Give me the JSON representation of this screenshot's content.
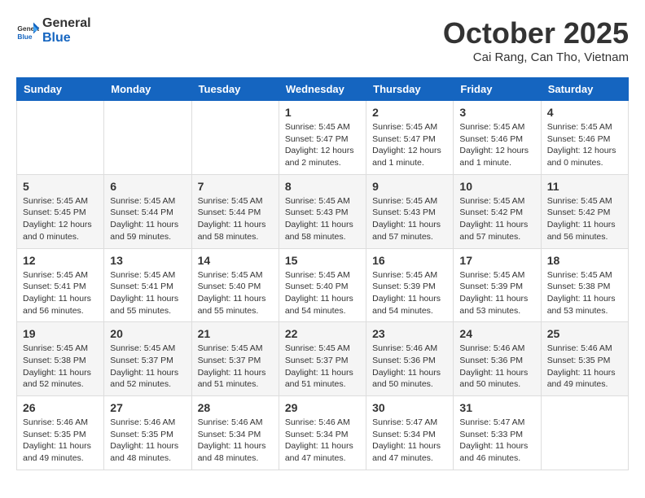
{
  "header": {
    "logo_general": "General",
    "logo_blue": "Blue",
    "month_title": "October 2025",
    "subtitle": "Cai Rang, Can Tho, Vietnam"
  },
  "days_of_week": [
    "Sunday",
    "Monday",
    "Tuesday",
    "Wednesday",
    "Thursday",
    "Friday",
    "Saturday"
  ],
  "weeks": [
    [
      null,
      null,
      null,
      {
        "day": "1",
        "info": "Sunrise: 5:45 AM\nSunset: 5:47 PM\nDaylight: 12 hours and 2 minutes."
      },
      {
        "day": "2",
        "info": "Sunrise: 5:45 AM\nSunset: 5:47 PM\nDaylight: 12 hours and 1 minute."
      },
      {
        "day": "3",
        "info": "Sunrise: 5:45 AM\nSunset: 5:46 PM\nDaylight: 12 hours and 1 minute."
      },
      {
        "day": "4",
        "info": "Sunrise: 5:45 AM\nSunset: 5:46 PM\nDaylight: 12 hours and 0 minutes."
      }
    ],
    [
      {
        "day": "5",
        "info": "Sunrise: 5:45 AM\nSunset: 5:45 PM\nDaylight: 12 hours and 0 minutes."
      },
      {
        "day": "6",
        "info": "Sunrise: 5:45 AM\nSunset: 5:44 PM\nDaylight: 11 hours and 59 minutes."
      },
      {
        "day": "7",
        "info": "Sunrise: 5:45 AM\nSunset: 5:44 PM\nDaylight: 11 hours and 58 minutes."
      },
      {
        "day": "8",
        "info": "Sunrise: 5:45 AM\nSunset: 5:43 PM\nDaylight: 11 hours and 58 minutes."
      },
      {
        "day": "9",
        "info": "Sunrise: 5:45 AM\nSunset: 5:43 PM\nDaylight: 11 hours and 57 minutes."
      },
      {
        "day": "10",
        "info": "Sunrise: 5:45 AM\nSunset: 5:42 PM\nDaylight: 11 hours and 57 minutes."
      },
      {
        "day": "11",
        "info": "Sunrise: 5:45 AM\nSunset: 5:42 PM\nDaylight: 11 hours and 56 minutes."
      }
    ],
    [
      {
        "day": "12",
        "info": "Sunrise: 5:45 AM\nSunset: 5:41 PM\nDaylight: 11 hours and 56 minutes."
      },
      {
        "day": "13",
        "info": "Sunrise: 5:45 AM\nSunset: 5:41 PM\nDaylight: 11 hours and 55 minutes."
      },
      {
        "day": "14",
        "info": "Sunrise: 5:45 AM\nSunset: 5:40 PM\nDaylight: 11 hours and 55 minutes."
      },
      {
        "day": "15",
        "info": "Sunrise: 5:45 AM\nSunset: 5:40 PM\nDaylight: 11 hours and 54 minutes."
      },
      {
        "day": "16",
        "info": "Sunrise: 5:45 AM\nSunset: 5:39 PM\nDaylight: 11 hours and 54 minutes."
      },
      {
        "day": "17",
        "info": "Sunrise: 5:45 AM\nSunset: 5:39 PM\nDaylight: 11 hours and 53 minutes."
      },
      {
        "day": "18",
        "info": "Sunrise: 5:45 AM\nSunset: 5:38 PM\nDaylight: 11 hours and 53 minutes."
      }
    ],
    [
      {
        "day": "19",
        "info": "Sunrise: 5:45 AM\nSunset: 5:38 PM\nDaylight: 11 hours and 52 minutes."
      },
      {
        "day": "20",
        "info": "Sunrise: 5:45 AM\nSunset: 5:37 PM\nDaylight: 11 hours and 52 minutes."
      },
      {
        "day": "21",
        "info": "Sunrise: 5:45 AM\nSunset: 5:37 PM\nDaylight: 11 hours and 51 minutes."
      },
      {
        "day": "22",
        "info": "Sunrise: 5:45 AM\nSunset: 5:37 PM\nDaylight: 11 hours and 51 minutes."
      },
      {
        "day": "23",
        "info": "Sunrise: 5:46 AM\nSunset: 5:36 PM\nDaylight: 11 hours and 50 minutes."
      },
      {
        "day": "24",
        "info": "Sunrise: 5:46 AM\nSunset: 5:36 PM\nDaylight: 11 hours and 50 minutes."
      },
      {
        "day": "25",
        "info": "Sunrise: 5:46 AM\nSunset: 5:35 PM\nDaylight: 11 hours and 49 minutes."
      }
    ],
    [
      {
        "day": "26",
        "info": "Sunrise: 5:46 AM\nSunset: 5:35 PM\nDaylight: 11 hours and 49 minutes."
      },
      {
        "day": "27",
        "info": "Sunrise: 5:46 AM\nSunset: 5:35 PM\nDaylight: 11 hours and 48 minutes."
      },
      {
        "day": "28",
        "info": "Sunrise: 5:46 AM\nSunset: 5:34 PM\nDaylight: 11 hours and 48 minutes."
      },
      {
        "day": "29",
        "info": "Sunrise: 5:46 AM\nSunset: 5:34 PM\nDaylight: 11 hours and 47 minutes."
      },
      {
        "day": "30",
        "info": "Sunrise: 5:47 AM\nSunset: 5:34 PM\nDaylight: 11 hours and 47 minutes."
      },
      {
        "day": "31",
        "info": "Sunrise: 5:47 AM\nSunset: 5:33 PM\nDaylight: 11 hours and 46 minutes."
      },
      null
    ]
  ]
}
